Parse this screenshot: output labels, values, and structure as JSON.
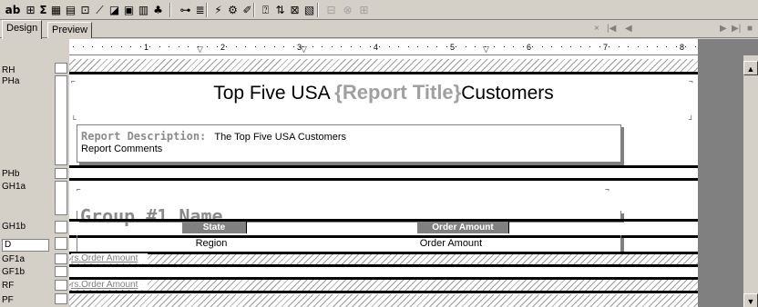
{
  "toolbar": {
    "buttons": [
      {
        "name": "text-object-icon",
        "glyph": "ab",
        "bold": true
      },
      {
        "name": "field-object-icon",
        "glyph": "⊞"
      },
      {
        "name": "summary-icon",
        "glyph": "Σ",
        "bold": true
      },
      {
        "name": "cross-tab-icon",
        "glyph": "▦"
      },
      {
        "name": "grid-icon",
        "glyph": "▤"
      },
      {
        "name": "ole-icon",
        "glyph": "⊡"
      },
      {
        "name": "line-icon",
        "glyph": "⟋"
      },
      {
        "name": "box-icon",
        "glyph": "◪"
      },
      {
        "name": "picture-icon",
        "glyph": "▣"
      },
      {
        "name": "chart-icon",
        "glyph": "▥"
      },
      {
        "name": "map-icon",
        "glyph": "♣"
      },
      {
        "name": "insert-group-icon",
        "glyph": "⊶"
      },
      {
        "name": "section-expert-icon",
        "glyph": "≣"
      },
      {
        "name": "select-expert-icon",
        "glyph": "⚡"
      },
      {
        "name": "formula-workshop-icon",
        "glyph": "⚙"
      },
      {
        "name": "format-painter-icon",
        "glyph": "✐"
      },
      {
        "name": "field-explorer-icon",
        "glyph": "⍰"
      },
      {
        "name": "sort-icon",
        "glyph": "⇅"
      },
      {
        "name": "report-explorer-icon",
        "glyph": "⊠"
      },
      {
        "name": "repository-icon",
        "glyph": "▧"
      },
      {
        "name": "disabled-tool-1-icon",
        "glyph": "⊟"
      },
      {
        "name": "disabled-tool-2-icon",
        "glyph": "⊗"
      },
      {
        "name": "disabled-tool-3-icon",
        "glyph": "⊞"
      }
    ]
  },
  "tabs": [
    {
      "label": "Design",
      "active": true
    },
    {
      "label": "Preview",
      "active": false
    }
  ],
  "nav": {
    "close_glyph": "×",
    "first_glyph": "|◀",
    "prev_glyph": "◀",
    "next_glyph": "▶",
    "last_glyph": "▶|",
    "stop_glyph": "■"
  },
  "ruler": {
    "numbers": [
      "1",
      "2",
      "3",
      "4",
      "5",
      "6",
      "7",
      "8"
    ]
  },
  "sections": [
    {
      "label": "RH"
    },
    {
      "label": "PHa"
    },
    {
      "label": "PHb"
    },
    {
      "label": "GH1a"
    },
    {
      "label": "GH1b"
    },
    {
      "label": "D"
    },
    {
      "label": "GF1a"
    },
    {
      "label": "GF1b"
    },
    {
      "label": "RF"
    },
    {
      "label": "PF"
    }
  ],
  "report": {
    "title_prefix": "Top Five USA ",
    "title_param": "{Report Title}",
    "title_suffix": "Customers",
    "desc_label": "Report Description:",
    "desc_value": "The Top Five USA Customers",
    "comments": "Report Comments",
    "group_name": "Group #1 Name",
    "col_state": "State",
    "col_order_amount": "Order Amount",
    "field_region": "Region",
    "field_order_amount": "Order Amount",
    "group_footer_sum": "rs.Order Amount",
    "report_footer_sum": "rs.Order Amount"
  }
}
